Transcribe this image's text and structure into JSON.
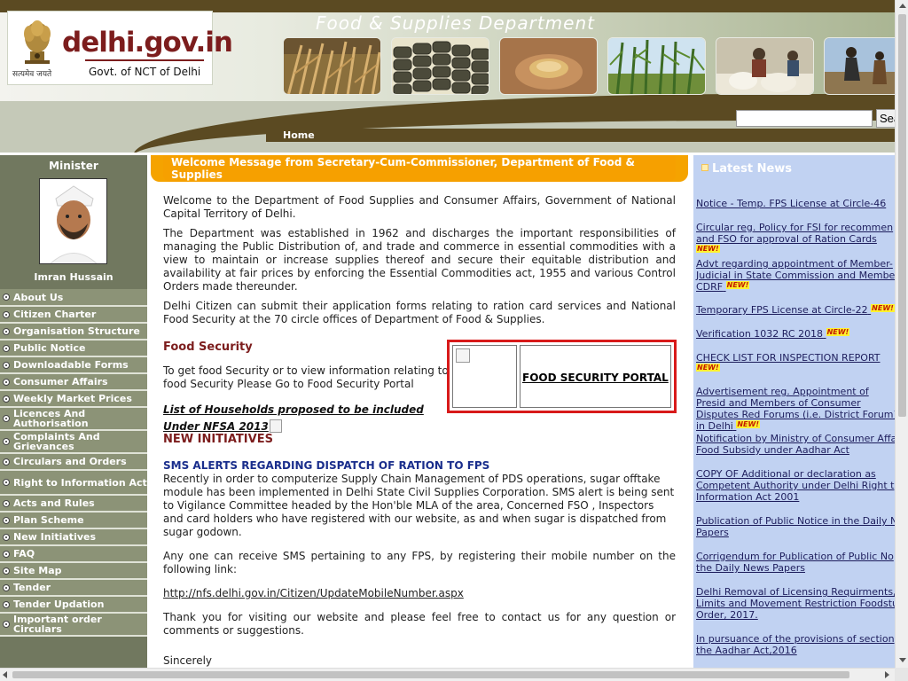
{
  "header": {
    "site_name": "delhi.gov.in",
    "site_subtitle": "Govt. of NCT of Delhi",
    "emblem_caption": "सत्यमेव जयते",
    "department_title": "Food & Supplies Department",
    "home_label": "Home",
    "search": {
      "value": "",
      "placeholder": "",
      "button_label": "Search"
    },
    "photos": [
      {
        "subject": "wheat-field"
      },
      {
        "subject": "grain-sacks"
      },
      {
        "subject": "grain-in-hands"
      },
      {
        "subject": "sugarcane-field"
      },
      {
        "subject": "ration-distribution"
      },
      {
        "subject": "harvest-workers"
      }
    ]
  },
  "sidebar": {
    "minister_title": "Minister",
    "minister_name": "Imran Hussain",
    "nav": [
      "About Us",
      "Citizen Charter",
      "Organisation Structure",
      "Public Notice",
      "Downloadable Forms",
      "Consumer Affairs",
      "Weekly Market Prices",
      "Licences And Authorisation",
      "Complaints And Grievances",
      "Circulars and Orders",
      "Right to Information Act",
      "Acts and Rules",
      "Plan Scheme",
      "New Initiatives",
      "FAQ",
      "Site Map",
      "Tender",
      "Tender Updation",
      "Important order Circulars"
    ]
  },
  "main": {
    "welcome_title": "Welcome Message from Secretary-Cum-Commissioner, Department of Food & Supplies",
    "para1": "Welcome to the Department of Food Supplies and Consumer Affairs, Government of National Capital Territory of Delhi.",
    "para2": "The Department was established in 1962 and discharges the important responsibilities of managing the Public Distribution of, and trade and commerce in essential commodities with a view to maintain or increase supplies thereof and secure their equitable distribution and availability at fair prices by enforcing the Essential Commodities act, 1955 and various Control Orders made thereunder.",
    "para3": "Delhi Citizen can submit their application forms relating to ration card services and National Food Security at the 70 circle offices of Department of Food & Supplies.",
    "food_security_heading": "Food Security",
    "food_security_text": "To get food Security or to view information relating to food Security Please Go to Food Security Portal",
    "portal_link": "FOOD SECURITY PORTAL",
    "households_link": "List of Households proposed to be included Under NFSA 2013",
    "new_initiatives": "NEW INITIATIVES",
    "sms_heading": "SMS ALERTS REGARDING DISPATCH OF RATION TO FPS",
    "sms_text": "Recently in order to computerize Supply Chain Management of PDS operations, sugar offtake module has been implemented in Delhi State Civil Supplies Corporation. SMS alert is being sent to Vigilance Committee headed by the Hon'ble MLA of the area, Concerned FSO , Inspectors and card holders who have registered with our website, as and when sugar is dispatched from sugar godown.",
    "register_text": "Any one can receive SMS pertaining to any FPS, by registering their mobile number on the following link:",
    "update_link": "http://nfs.delhi.gov.in/Citizen/UpdateMobileNumber.aspx",
    "thanks_text": "Thank you for visiting our website and please feel free to contact us for any question or comments or suggestions.",
    "sign_off": "Sincerely"
  },
  "news": {
    "header": "Latest News",
    "new_badge": "NEW!",
    "items": [
      {
        "text": "Notice - Temp. FPS License at Circle-46",
        "new": false
      },
      {
        "text": "Circular reg. Policy for FSI for recommen and FSO for approval of Ration Cards",
        "new": true
      },
      {
        "text": "Advt regarding appointment of Member-Judicial in State Commission and Member CDRF",
        "new": true
      },
      {
        "text": "Temporary FPS License at Circle-22",
        "new": true
      },
      {
        "text": "Verification 1032 RC 2018",
        "new": true
      },
      {
        "text": "CHECK LIST FOR INSPECTION REPORT",
        "new": true
      },
      {
        "text": "Advertisement reg. Appointment of Presid and Members of Consumer Disputes Red Forums (i.e. District Forum) in Delhi",
        "new": true
      },
      {
        "text": "Notification by Ministry of Consumer Affa Food Subsidy under Aadhar Act",
        "new": false
      },
      {
        "text": "COPY OF Additional or declaration as Competent Authority under Delhi Right t Information Act 2001",
        "new": false
      },
      {
        "text": "Publication of Public Notice in the Daily N Papers",
        "new": false
      },
      {
        "text": "Corrigendum for Publication of Public No the Daily News Papers",
        "new": false
      },
      {
        "text": "Delhi Removal of Licensing Requirments, Limits and Movement Restriction Foodstu Order, 2017.",
        "new": false
      },
      {
        "text": "In pursuance of the provisions of section the Aadhar Act,2016",
        "new": false
      }
    ]
  },
  "colors": {
    "header_brown": "#5b4a22",
    "sidebar_green": "#71785f",
    "nav_bg": "#8c9377",
    "banner_orange": "#f5a300",
    "news_bg": "#c1d2f2",
    "heading_maroon": "#7c1d1d",
    "sms_blue": "#1a2e8c",
    "portal_border": "#d81a1a"
  }
}
